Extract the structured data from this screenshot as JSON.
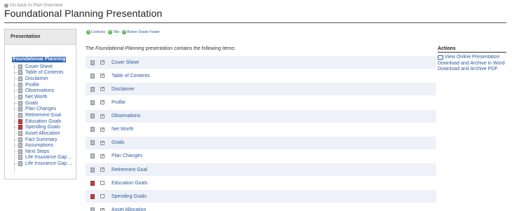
{
  "nav": {
    "back_label": "Go back to Plan Overview"
  },
  "header": {
    "title": "Foundational Planning Presentation"
  },
  "sidebar": {
    "heading": "Presentation",
    "root_label": "Foundational Planning",
    "items": [
      {
        "label": "Cover Sheet",
        "icon": "document-icon"
      },
      {
        "label": "Table of Contents",
        "icon": "document-icon"
      },
      {
        "label": "Disclaimer",
        "icon": "document-icon"
      },
      {
        "label": "Profile",
        "icon": "document-icon"
      },
      {
        "label": "Observations",
        "icon": "document-icon"
      },
      {
        "label": "Net Worth",
        "icon": "document-icon"
      },
      {
        "label": "Goals",
        "icon": "document-icon"
      },
      {
        "label": "Plan Changes",
        "icon": "document-icon"
      },
      {
        "label": "Retirement Goal",
        "icon": "document-icon"
      },
      {
        "label": "Education Goals",
        "icon": "document-icon-red"
      },
      {
        "label": "Spending Goals",
        "icon": "document-icon-red"
      },
      {
        "label": "Asset Allocation",
        "icon": "document-icon"
      },
      {
        "label": "Fact Summary",
        "icon": "document-icon"
      },
      {
        "label": "Assumptions",
        "icon": "document-icon"
      },
      {
        "label": "Next Steps",
        "icon": "document-icon"
      },
      {
        "label": "Life Insurance Gap ...",
        "icon": "document-icon"
      },
      {
        "label": "Life Insurance Gap ...",
        "icon": "document-icon"
      }
    ]
  },
  "tabs": [
    {
      "label": "Contents"
    },
    {
      "label": "Title"
    },
    {
      "label": "Broker Dealer Footer"
    }
  ],
  "main": {
    "intro_prefix": "The ",
    "intro_name": "Foundational Planning",
    "intro_suffix": " presentation contains the following items:",
    "items": [
      {
        "label": "Cover Sheet",
        "checked": true,
        "icon": "document-icon"
      },
      {
        "label": "Table of Contents",
        "checked": true,
        "icon": "document-icon"
      },
      {
        "label": "Disclaimer",
        "checked": true,
        "icon": "document-icon"
      },
      {
        "label": "Profile",
        "checked": true,
        "icon": "document-icon"
      },
      {
        "label": "Observations",
        "checked": true,
        "icon": "document-icon"
      },
      {
        "label": "Net Worth",
        "checked": true,
        "icon": "document-icon"
      },
      {
        "label": "Goals",
        "checked": true,
        "icon": "document-icon"
      },
      {
        "label": "Plan Changes",
        "checked": true,
        "icon": "document-icon"
      },
      {
        "label": "Retirement Goal",
        "checked": true,
        "icon": "document-icon"
      },
      {
        "label": "Education Goals",
        "checked": false,
        "icon": "document-icon-red"
      },
      {
        "label": "Spending Goals",
        "checked": false,
        "icon": "document-icon-red"
      },
      {
        "label": "Asset Allocation",
        "checked": true,
        "icon": "document-icon"
      }
    ]
  },
  "actions": {
    "heading": "Actions",
    "items": [
      {
        "label": "View Online Presentation",
        "icon": "monitor-icon"
      },
      {
        "label": "Download and Archive in Word"
      },
      {
        "label": "Download and Archive PDF"
      }
    ]
  },
  "colors": {
    "accent": "#2b63b8",
    "link": "#2b5aa0",
    "row_alt": "#eef1f7",
    "plus": "#4caf50"
  }
}
